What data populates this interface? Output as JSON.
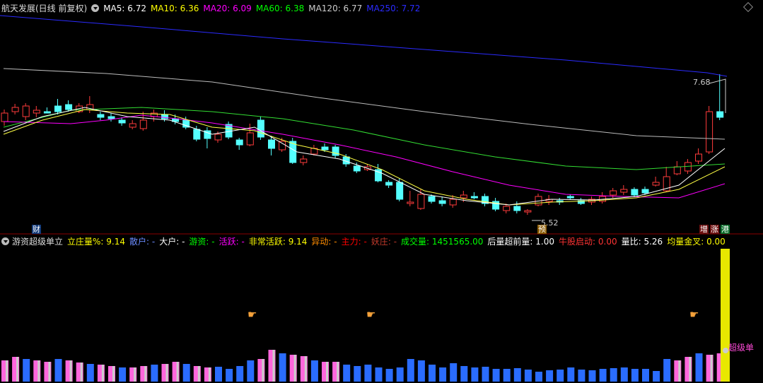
{
  "header": {
    "title": "航天发展(日线 前复权)",
    "ma": [
      {
        "label": "MA5: 6.72",
        "color": "#ffffff"
      },
      {
        "label": "MA10: 6.36",
        "color": "#ffff00"
      },
      {
        "label": "MA20: 6.09",
        "color": "#ff00ff"
      },
      {
        "label": "MA60: 6.38",
        "color": "#00ff00"
      },
      {
        "label": "MA120: 6.77",
        "color": "#cccccc"
      },
      {
        "label": "MA250: 7.72",
        "color": "#2b2bff"
      }
    ]
  },
  "price_marks": {
    "high": "7.68",
    "low": "5.52"
  },
  "tags": {
    "cai": "财",
    "yu": "预",
    "zeng": "增",
    "zhang": "涨",
    "gang": "港",
    "super": "超级单"
  },
  "indicator": {
    "name": "游资超级单立",
    "items": [
      {
        "k": "立庄量%:",
        "v": "9.14",
        "kc": "#ffff00",
        "vc": "#ffff00"
      },
      {
        "k": "散户:",
        "v": "-",
        "kc": "#6b8cff",
        "vc": "#6b8cff"
      },
      {
        "k": "大户:",
        "v": "-",
        "kc": "#ffffff",
        "vc": "#ffffff"
      },
      {
        "k": "游资:",
        "v": "-",
        "kc": "#00ff00",
        "vc": "#00ff00"
      },
      {
        "k": "活跃:",
        "v": "-",
        "kc": "#ff00ff",
        "vc": "#ff00ff"
      },
      {
        "k": "非常活跃:",
        "v": "9.14",
        "kc": "#ffff00",
        "vc": "#ffff00"
      },
      {
        "k": "异动:",
        "v": "-",
        "kc": "#ff8c00",
        "vc": "#ff8c00"
      },
      {
        "k": "主力:",
        "v": "-",
        "kc": "#ff0000",
        "vc": "#ff0000"
      },
      {
        "k": "妖庄:",
        "v": "-",
        "kc": "#c0392b",
        "vc": "#c0392b"
      },
      {
        "k": "成交量:",
        "v": "1451565.00",
        "kc": "#00ff00",
        "vc": "#00ff00"
      },
      {
        "k": "后量超前量:",
        "v": "1.00",
        "kc": "#ffffff",
        "vc": "#ffffff"
      },
      {
        "k": "牛股启动:",
        "v": "0.00",
        "kc": "#ff3333",
        "vc": "#ff3333"
      },
      {
        "k": "量比:",
        "v": "5.26",
        "kc": "#ffffff",
        "vc": "#ffffff"
      },
      {
        "k": "均量金叉:",
        "v": "0.00",
        "kc": "#ffff00",
        "vc": "#ffff00"
      }
    ]
  }
}
